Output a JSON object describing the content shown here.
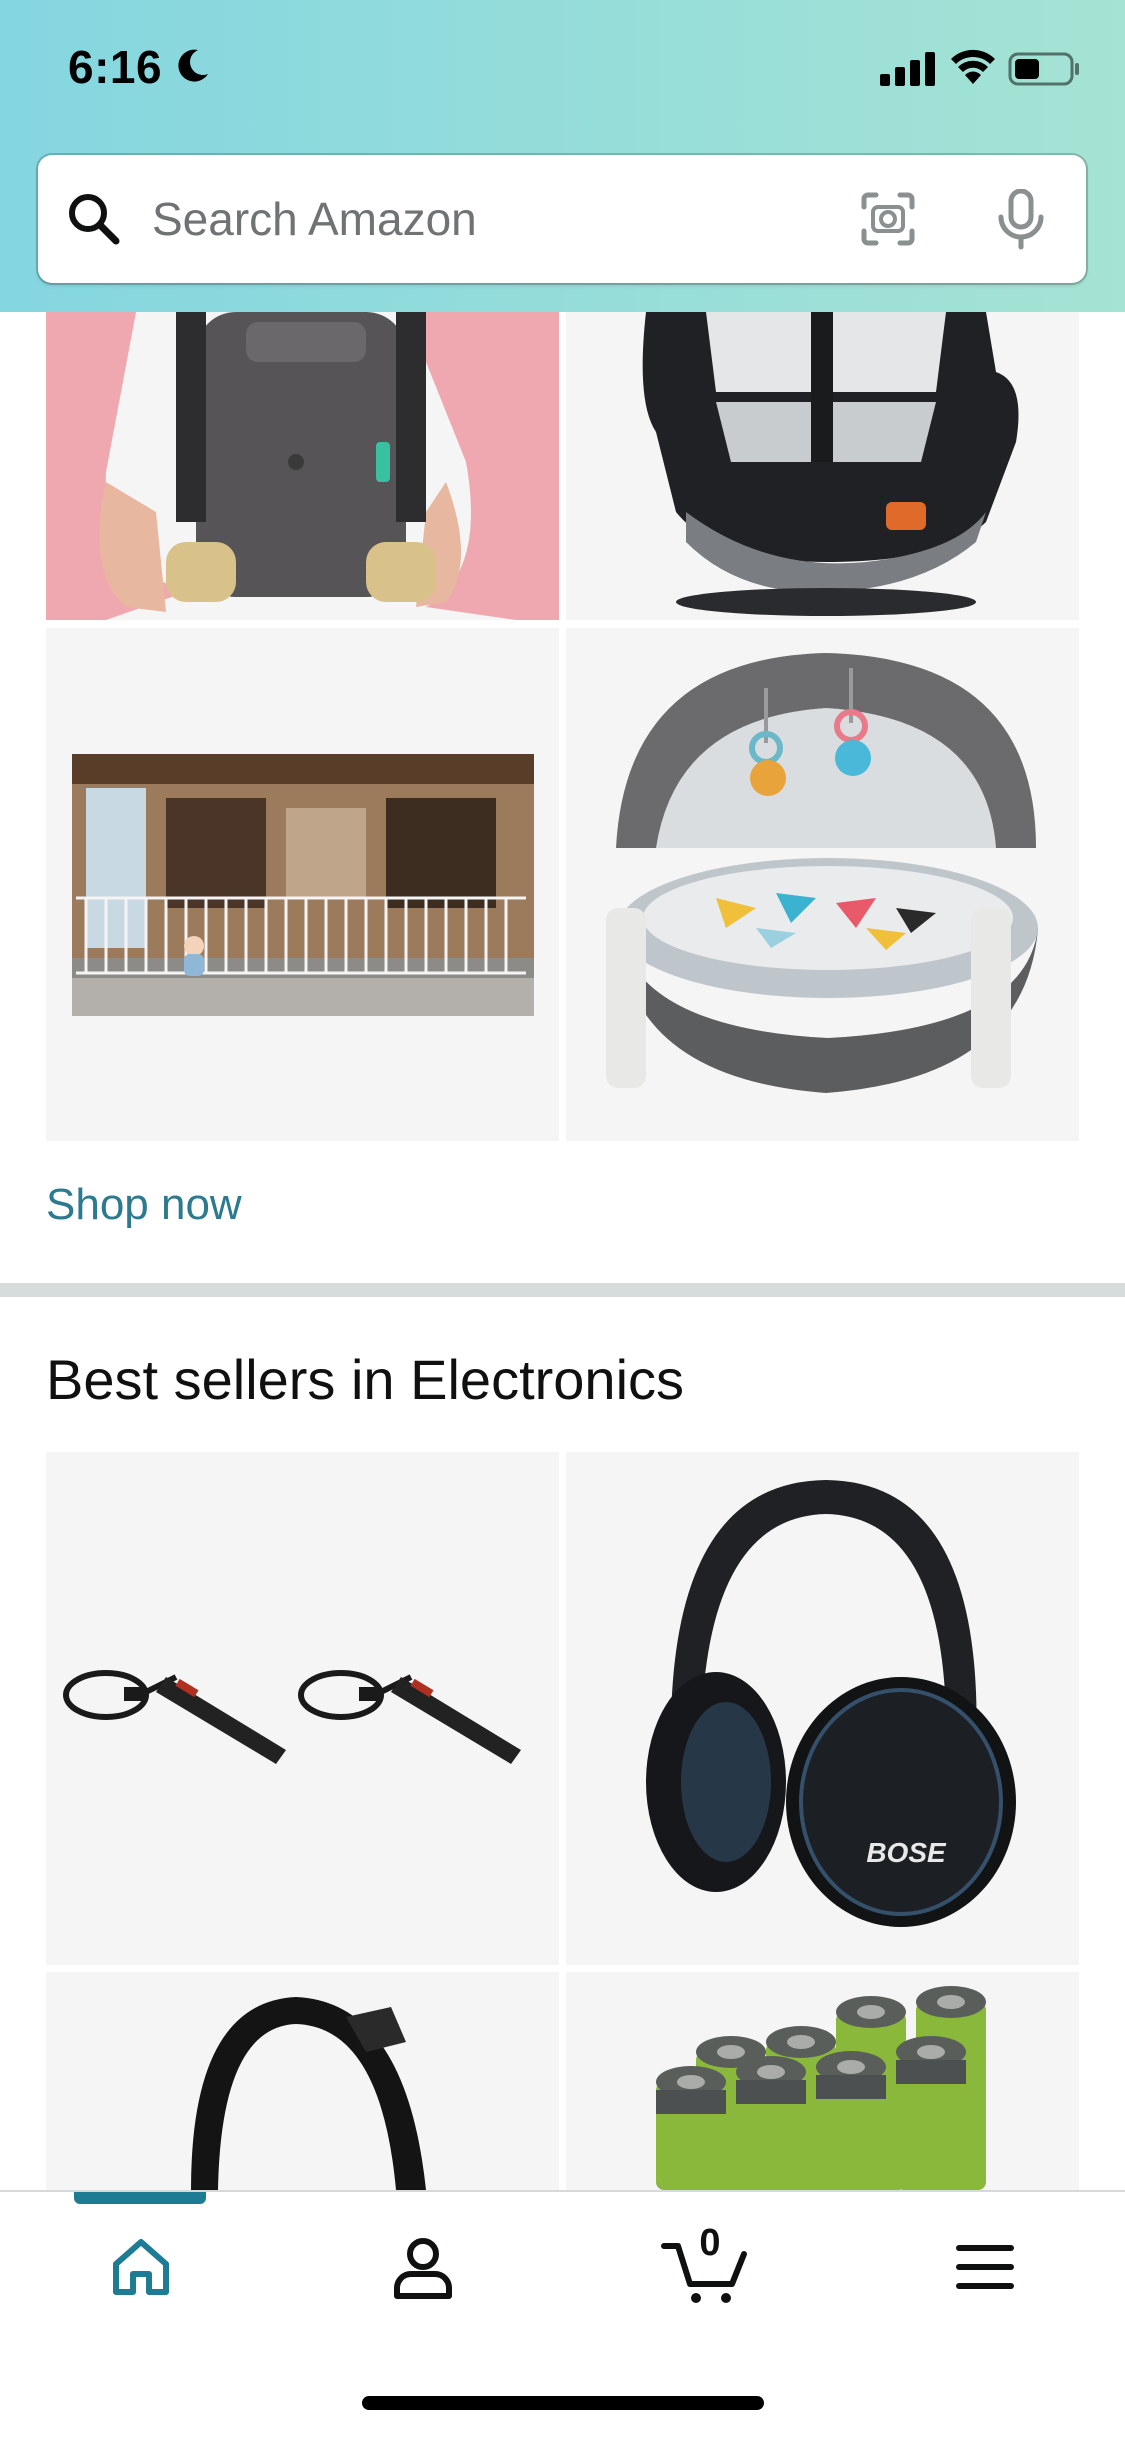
{
  "status_bar": {
    "time": "6:16",
    "icons": [
      "moon-icon",
      "cellular-signal-icon",
      "wifi-icon",
      "battery-icon"
    ]
  },
  "search": {
    "placeholder": "Search Amazon",
    "icons": [
      "search-icon",
      "camera-scan-icon",
      "microphone-icon"
    ]
  },
  "baby_section": {
    "products": [
      {
        "name": "baby-carrier-image"
      },
      {
        "name": "car-seat-image"
      },
      {
        "name": "baby-gate-image"
      },
      {
        "name": "play-dome-image"
      }
    ],
    "link": "Shop now"
  },
  "electronics_section": {
    "title": "Best sellers in Electronics",
    "products": [
      {
        "name": "power-strip-image"
      },
      {
        "name": "bose-headphones-image",
        "brand_text": "BOSE"
      },
      {
        "name": "black-headphones-image"
      },
      {
        "name": "batteries-image"
      }
    ]
  },
  "bottom_nav": {
    "items": [
      "home-icon",
      "account-icon",
      "cart-icon",
      "menu-icon"
    ],
    "cart_count": "0",
    "active_index": 0
  },
  "colors": {
    "accent": "#1d7c94",
    "link": "#2c7a8f",
    "header_gradient_start": "#84d6e0",
    "header_gradient_end": "#a5e3d4",
    "tile_background": "#f5f5f5"
  }
}
